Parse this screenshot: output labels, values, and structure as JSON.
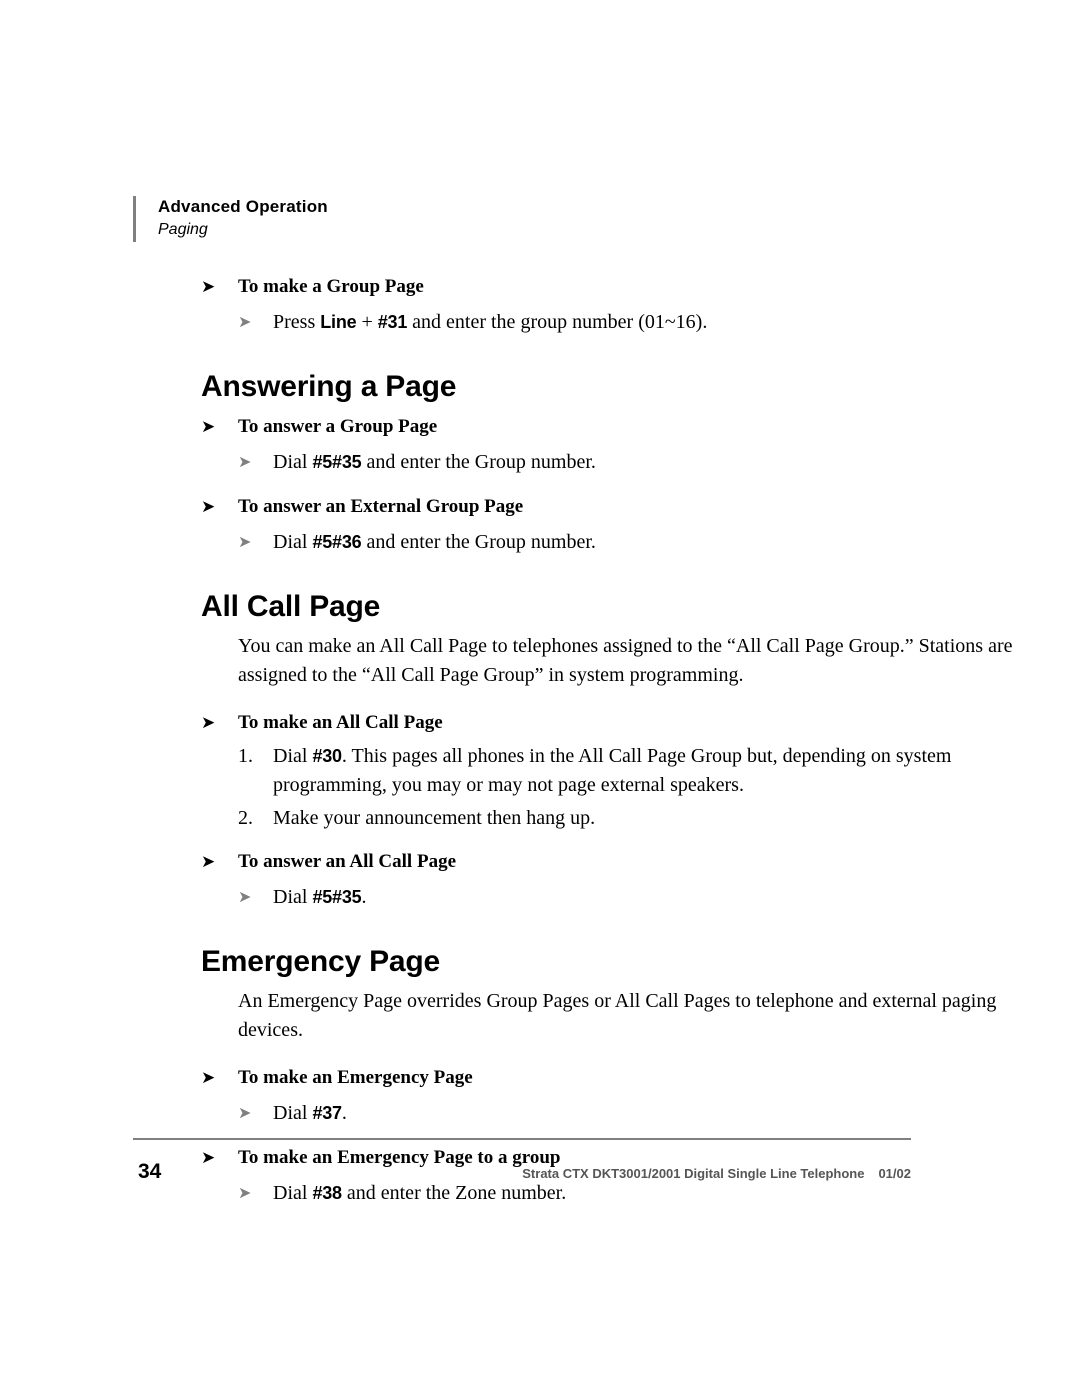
{
  "header": {
    "chapter": "Advanced Operation",
    "topic": "Paging"
  },
  "content": {
    "group_page": {
      "heading": "To make a Group Page",
      "step": {
        "prefix": "Press ",
        "code1": "Line",
        "mid": " + ",
        "code2": "#31",
        "suffix": " and enter the group number (01~16)."
      }
    },
    "answering_a_page": {
      "title": "Answering a Page",
      "answer_group": {
        "heading": "To answer a Group Page",
        "step": {
          "prefix": "Dial ",
          "code": "#5#35",
          "suffix": " and enter the Group number."
        }
      },
      "answer_external_group": {
        "heading": "To answer an External Group Page",
        "step": {
          "prefix": "Dial ",
          "code": "#5#36",
          "suffix": " and enter the Group number."
        }
      }
    },
    "all_call_page": {
      "title": "All Call Page",
      "intro": "You can make an All Call Page to telephones assigned to the “All Call Page Group.” Stations are assigned to the “All Call Page Group” in system programming.",
      "make": {
        "heading": "To make an All Call Page",
        "steps": [
          {
            "num": "1.",
            "prefix": "Dial ",
            "code": "#30",
            "suffix": ". This pages all phones in the All Call Page Group but, depending on system programming, you may or may not page external speakers."
          },
          {
            "num": "2.",
            "prefix": "Make your announcement then hang up.",
            "code": "",
            "suffix": ""
          }
        ]
      },
      "answer": {
        "heading": "To answer an All Call Page",
        "step": {
          "prefix": "Dial ",
          "code": "#5#35",
          "suffix": "."
        }
      }
    },
    "emergency_page": {
      "title": "Emergency Page",
      "intro": "An Emergency Page overrides Group Pages or All Call Pages to telephone and external paging devices.",
      "make": {
        "heading": "To make an Emergency Page",
        "step": {
          "prefix": "Dial ",
          "code": "#37",
          "suffix": "."
        }
      },
      "make_group": {
        "heading": "To make an Emergency Page to a group",
        "step": {
          "prefix": "Dial ",
          "code": "#38",
          "suffix": " and enter the Zone number."
        }
      }
    }
  },
  "footer": {
    "page_number": "34",
    "doc_title": "Strata CTX DKT3001/2001 Digital Single Line Telephone",
    "doc_date": "01/02"
  },
  "icons": {
    "arrow_black": "➤",
    "arrow_gray": "➤"
  }
}
